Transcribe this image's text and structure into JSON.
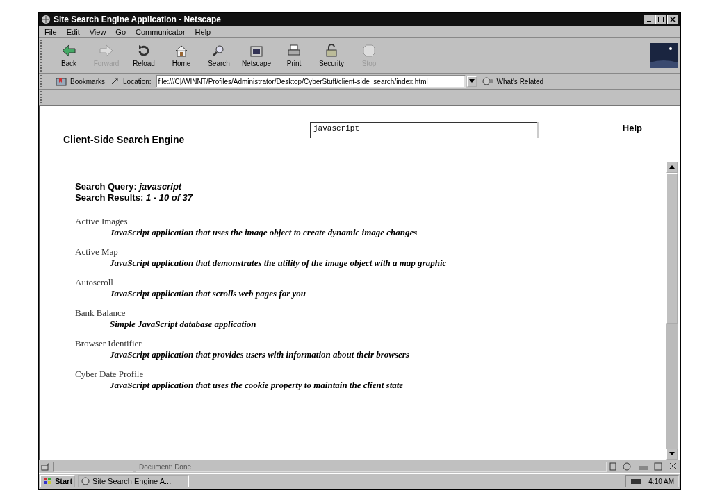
{
  "window": {
    "title": "Site Search Engine Application - Netscape"
  },
  "menu": [
    "File",
    "Edit",
    "View",
    "Go",
    "Communicator",
    "Help"
  ],
  "toolbar": [
    {
      "label": "Back",
      "kind": "back",
      "disabled": false
    },
    {
      "label": "Forward",
      "kind": "forward",
      "disabled": true
    },
    {
      "label": "Reload",
      "kind": "reload",
      "disabled": false
    },
    {
      "label": "Home",
      "kind": "home",
      "disabled": false
    },
    {
      "label": "Search",
      "kind": "search",
      "disabled": false
    },
    {
      "label": "Netscape",
      "kind": "netscape",
      "disabled": false
    },
    {
      "label": "Print",
      "kind": "print",
      "disabled": false
    },
    {
      "label": "Security",
      "kind": "security",
      "disabled": false
    },
    {
      "label": "Stop",
      "kind": "stop",
      "disabled": true
    }
  ],
  "location_bar": {
    "bookmarks": "Bookmarks",
    "location_label": "Location:",
    "url": "file:///C|/WINNT/Profiles/Administrator/Desktop/CyberStuff/client-side_search/index.html",
    "related": "What's Related"
  },
  "header_frame": {
    "title": "Client-Side Search Engine",
    "search_value": "javascript",
    "help": "Help"
  },
  "results_frame": {
    "query": "Search Query: *javascript*",
    "summary": "Search Results: *1 - 10 of 37*",
    "results": [
      {
        "title": "Active Images",
        "description": "JavaScript application that uses the image object to create dynamic image changes"
      },
      {
        "title": "Active Map",
        "description": "JavaScript application that demonstrates the utility of the image object with a map graphic"
      },
      {
        "title": "Autoscroll",
        "description": "JavaScript application that scrolls web pages for you"
      },
      {
        "title": "Bank Balance",
        "description": "Simple JavaScript database application"
      },
      {
        "title": "Browser Identifier",
        "description": "JavaScript application that provides users with information about their browsers"
      },
      {
        "title": "Cyber Date Profile",
        "description": "JavaScript application that uses the cookie property to maintain the client state"
      }
    ]
  },
  "status_bar": {
    "text": "Document: Done"
  },
  "taskbar": {
    "start": "Start",
    "task": "Site Search Engine A...",
    "clock": "4:10 AM"
  }
}
